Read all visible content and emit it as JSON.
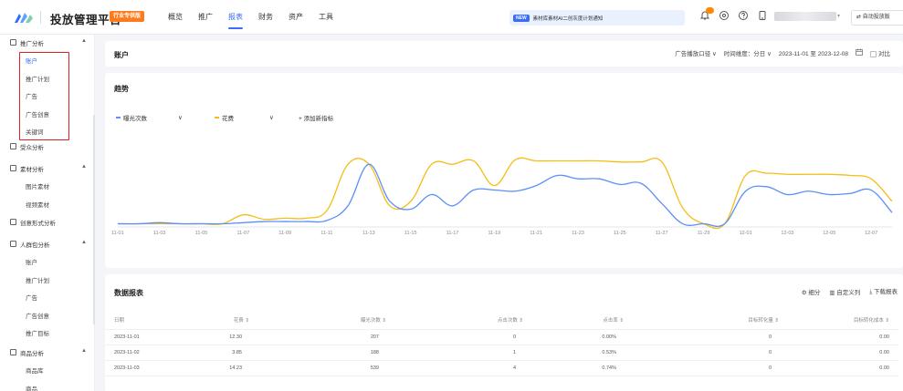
{
  "header": {
    "brand": "投放管理平台",
    "badge": "行业专供版",
    "nav": [
      "概览",
      "推广",
      "报表",
      "财务",
      "资产",
      "工具"
    ],
    "nav_active": 2,
    "notice_tag": "NEW",
    "notice_text": "素材库素材AI二创灰度计划通知",
    "auto_button": "⇄ 自动投放版",
    "icons": [
      "bell-icon",
      "help-circle-icon",
      "question-icon",
      "mobile-icon"
    ],
    "accent": "#3b6cf6"
  },
  "sidebar": {
    "groups": [
      {
        "label": "推广分析",
        "icon": "chart-icon",
        "caret": "▲",
        "items": [
          "账户",
          "推广计划",
          "广告",
          "广告创意",
          "关键词"
        ]
      },
      {
        "label": "受众分析",
        "icon": "users-icon",
        "caret": "",
        "items": []
      },
      {
        "label": "素材分析",
        "icon": "image-icon",
        "caret": "▲",
        "items": [
          "图片素材",
          "视频素材"
        ]
      },
      {
        "label": "创意形式分析",
        "icon": "bulb-icon",
        "caret": "",
        "items": []
      },
      {
        "label": "人群包分析",
        "icon": "group-icon",
        "caret": "▲",
        "items": [
          "账户",
          "推广计划",
          "广告",
          "广告创意",
          "推广目标"
        ]
      },
      {
        "label": "商品分析",
        "icon": "bag-icon",
        "caret": "▲",
        "items": [
          "商品库",
          "商品"
        ]
      }
    ],
    "active_item": "账户"
  },
  "account_card": {
    "title": "账户",
    "filter_scope": "广告播放口径 ∨",
    "filter_granularity": "时间维度：分日 ∨",
    "date_range": "2023-11-01 至 2023-12-08",
    "compare_label": "对比"
  },
  "trend_card": {
    "title": "趋势",
    "metric_1": "曝光次数",
    "metric_2": "花费",
    "add_metric": "+ 添加新指标",
    "colors": {
      "exposure": "#5b8ff9",
      "cost": "#f6bd16"
    }
  },
  "chart_data": {
    "type": "line",
    "x": [
      "11-01",
      "11-02",
      "11-03",
      "11-04",
      "11-05",
      "11-06",
      "11-07",
      "11-08",
      "11-09",
      "11-10",
      "11-11",
      "11-12",
      "11-13",
      "11-14",
      "11-15",
      "11-16",
      "11-17",
      "11-18",
      "11-19",
      "11-20",
      "11-21",
      "11-22",
      "11-23",
      "11-24",
      "11-25",
      "11-26",
      "11-27",
      "11-28",
      "11-29",
      "11-30",
      "12-01",
      "12-02",
      "12-03",
      "12-04",
      "12-05",
      "12-06",
      "12-07",
      "12-08"
    ],
    "x_tick_labels": [
      "11-01",
      "11-03",
      "11-05",
      "11-07",
      "11-09",
      "11-11",
      "11-13",
      "11-15",
      "11-17",
      "11-19",
      "11-21",
      "11-23",
      "11-25",
      "11-27",
      "11-29",
      "12-01",
      "12-03",
      "12-05",
      "12-07"
    ],
    "series": [
      {
        "name": "曝光次数",
        "color": "#5b8ff9",
        "values": [
          2,
          2,
          3,
          2,
          2,
          2,
          3,
          4,
          4,
          4,
          5,
          18,
          55,
          22,
          15,
          28,
          18,
          32,
          32,
          31,
          36,
          45,
          42,
          42,
          37,
          38,
          20,
          2,
          2,
          2,
          31,
          35,
          28,
          31,
          28,
          29,
          32,
          12
        ]
      },
      {
        "name": "花费",
        "color": "#f6bd16",
        "values": [
          2,
          2,
          2,
          2,
          2,
          2,
          10,
          6,
          7,
          7,
          14,
          55,
          55,
          18,
          22,
          55,
          55,
          58,
          36,
          59,
          58,
          58,
          58,
          58,
          57,
          57,
          57,
          16,
          2,
          2,
          45,
          47,
          46,
          46,
          46,
          45,
          42,
          22
        ]
      }
    ],
    "ylim": [
      0,
      60
    ],
    "grid": true,
    "legend": "top-left"
  },
  "table": {
    "title": "数据报表",
    "actions": [
      "⚙ 细分",
      "▥ 自定义列",
      "⤓ 下载报表"
    ],
    "columns": [
      "日期",
      "花费 ⇕",
      "曝光次数 ⇕",
      "点击次数 ⇕",
      "点击率 ⇕",
      "目标转化量 ⇕",
      "目标转化成本 ⇕"
    ],
    "rows": [
      [
        "2023-11-01",
        "12.30",
        "207",
        "0",
        "0.00%",
        "0",
        "0.00"
      ],
      [
        "2023-11-02",
        "3.85",
        "188",
        "1",
        "0.53%",
        "0",
        "0.00"
      ],
      [
        "2023-11-03",
        "14.23",
        "539",
        "4",
        "0.74%",
        "0",
        "0.00"
      ]
    ]
  }
}
